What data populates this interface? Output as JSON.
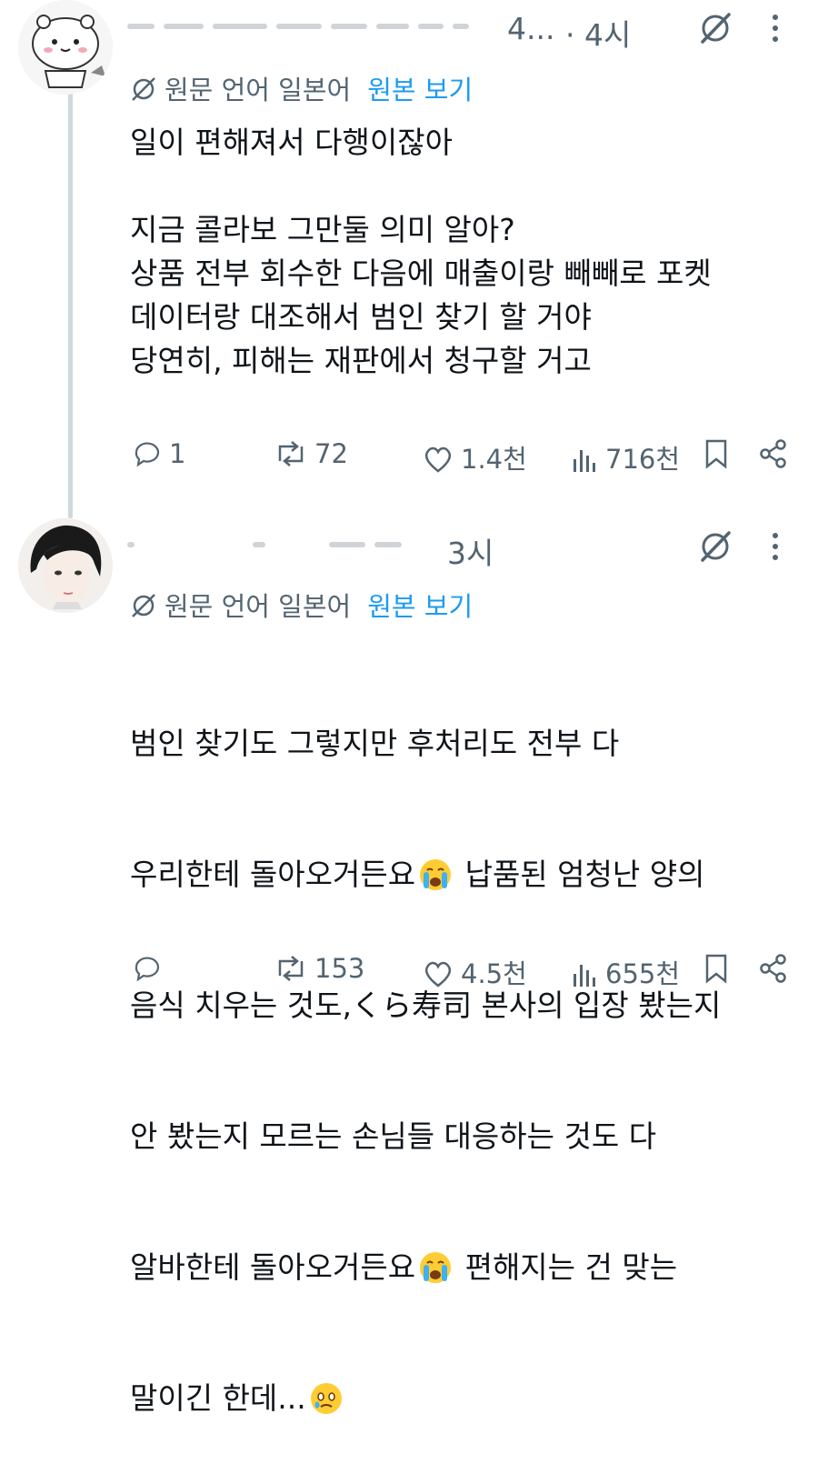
{
  "reply1": {
    "handle_tail": "4...",
    "time": "· 4시",
    "translate": {
      "lang_label": "원문 언어 일본어",
      "view_original": "원본 보기"
    },
    "body": "일이 편해져서 다행이잖아\n\n지금 콜라보 그만둘 의미 알아?\n상품 전부 회수한 다음에 매출이랑 빼빼로 포켓\n데이터랑 대조해서 범인 찾기 할 거야\n당연히, 피해는 재판에서 청구할 거고",
    "stats": {
      "replies": "1",
      "reposts": "72",
      "likes": "1.4천",
      "views": "716천"
    }
  },
  "reply2": {
    "time": "3시",
    "translate": {
      "lang_label": "원문 언어 일본어",
      "view_original": "원본 보기"
    },
    "lines": [
      "범인 찾기도 그렇지만 후처리도 전부 다",
      "우리한테 돌아오거든요",
      " 납품된 엄청난 양의",
      "음식 치우는 것도,くら寿司 본사의 입장 봤는지",
      "안 봤는지 모르는 손님들 대응하는 것도 다",
      "알바한테 돌아오거든요",
      " 편해지는 건 맞는",
      "말이긴 한데..."
    ],
    "emojis": [
      "crying-face",
      "crying-face",
      "face-holding-back-tears"
    ],
    "stats": {
      "replies": "",
      "reposts": "153",
      "likes": "4.5천",
      "views": "655천"
    }
  },
  "colors": {
    "text": "#0f1419",
    "secondary": "#536471",
    "link": "#1d9bf0",
    "thread": "#cfd9de"
  }
}
